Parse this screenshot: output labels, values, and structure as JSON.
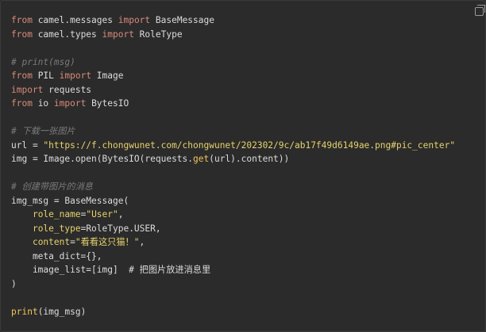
{
  "code_lines": [
    [
      {
        "t": "from",
        "c": "kw"
      },
      {
        "t": " camel.messages "
      },
      {
        "t": "import",
        "c": "kw"
      },
      {
        "t": " BaseMessage"
      }
    ],
    [
      {
        "t": "from",
        "c": "kw"
      },
      {
        "t": " camel.types "
      },
      {
        "t": "import",
        "c": "kw"
      },
      {
        "t": " RoleType"
      }
    ],
    [],
    [
      {
        "t": "# print(msg)",
        "c": "cmt"
      }
    ],
    [
      {
        "t": "from",
        "c": "kw"
      },
      {
        "t": " PIL "
      },
      {
        "t": "import",
        "c": "kw"
      },
      {
        "t": " Image"
      }
    ],
    [
      {
        "t": "import",
        "c": "kw"
      },
      {
        "t": " requests"
      }
    ],
    [
      {
        "t": "from",
        "c": "kw"
      },
      {
        "t": " io "
      },
      {
        "t": "import",
        "c": "kw"
      },
      {
        "t": " BytesIO"
      }
    ],
    [],
    [
      {
        "t": "# 下载一张图片",
        "c": "cmt"
      }
    ],
    [
      {
        "t": "url = "
      },
      {
        "t": "\"https://f.chongwunet.com/chongwunet/202302/9c/ab17f49d6149ae.png#pic_center\"",
        "c": "str"
      }
    ],
    [
      {
        "t": "img = Image.open(BytesIO(requests."
      },
      {
        "t": "get",
        "c": "fn"
      },
      {
        "t": "(url).content))"
      }
    ],
    [],
    [
      {
        "t": "# 创建带图片的消息",
        "c": "cmt"
      }
    ],
    [
      {
        "t": "img_msg = BaseMessage("
      }
    ],
    [
      {
        "t": "    "
      },
      {
        "t": "role_name",
        "c": "kwarg"
      },
      {
        "t": "="
      },
      {
        "t": "\"User\"",
        "c": "str"
      },
      {
        "t": ","
      }
    ],
    [
      {
        "t": "    "
      },
      {
        "t": "role_type",
        "c": "kwarg"
      },
      {
        "t": "=RoleType.USER,"
      }
    ],
    [
      {
        "t": "    "
      },
      {
        "t": "content",
        "c": "kwarg"
      },
      {
        "t": "="
      },
      {
        "t": "\"看看这只猫！\"",
        "c": "str"
      },
      {
        "t": ","
      }
    ],
    [
      {
        "t": "    meta_dict={},"
      }
    ],
    [
      {
        "t": "    image_list=[img]  # 把图片放进消息里"
      }
    ],
    [
      {
        "t": ")"
      }
    ],
    [],
    [
      {
        "t": "print",
        "c": "fn"
      },
      {
        "t": "(img_msg)"
      }
    ]
  ],
  "copy_button": {
    "icon": "copy-icon"
  }
}
